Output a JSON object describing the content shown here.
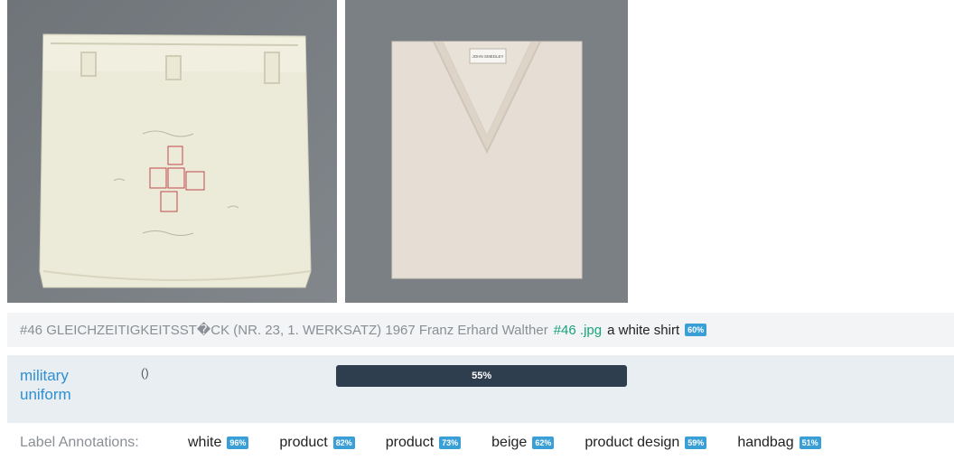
{
  "images": {
    "left_alt": "wrapped white package",
    "right_alt": "folded beige sweater",
    "label_text": "JOHN SMEDLEY"
  },
  "caption": {
    "title": "#46 GLEICHZEITIGKEITSST�CK (NR. 23, 1. WERKSATZ) 1967 Franz Erhard Walther",
    "link": "#46 .jpg",
    "description": "a white shirt",
    "score": "60%"
  },
  "category": {
    "label": "military uniform",
    "paren": "()",
    "percent_text": "55%",
    "percent": 0.55
  },
  "annotations": {
    "title": "Label Annotations:",
    "items": [
      {
        "label": "white",
        "score": "96%"
      },
      {
        "label": "product",
        "score": "82%"
      },
      {
        "label": "product",
        "score": "73%"
      },
      {
        "label": "beige",
        "score": "62%"
      },
      {
        "label": "product design",
        "score": "59%"
      },
      {
        "label": "handbag",
        "score": "51%"
      }
    ]
  }
}
